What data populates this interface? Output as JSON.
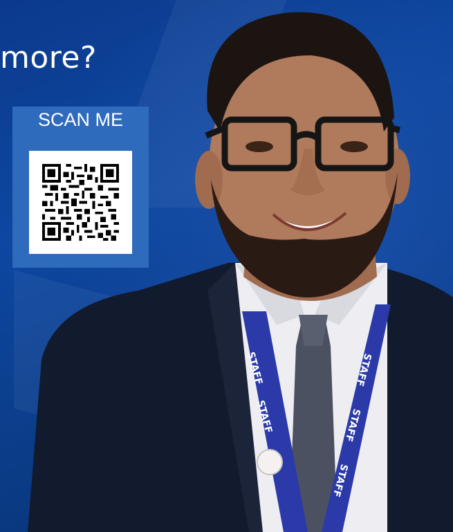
{
  "headline": "more?",
  "qr": {
    "title": "SCAN ME",
    "icon": "qr-code-icon"
  },
  "photo": {
    "lanyard_text": "STAFF",
    "colors": {
      "background": "#0d47a1",
      "card": "#2f6bbd",
      "lanyard": "#2b3aa8"
    }
  }
}
